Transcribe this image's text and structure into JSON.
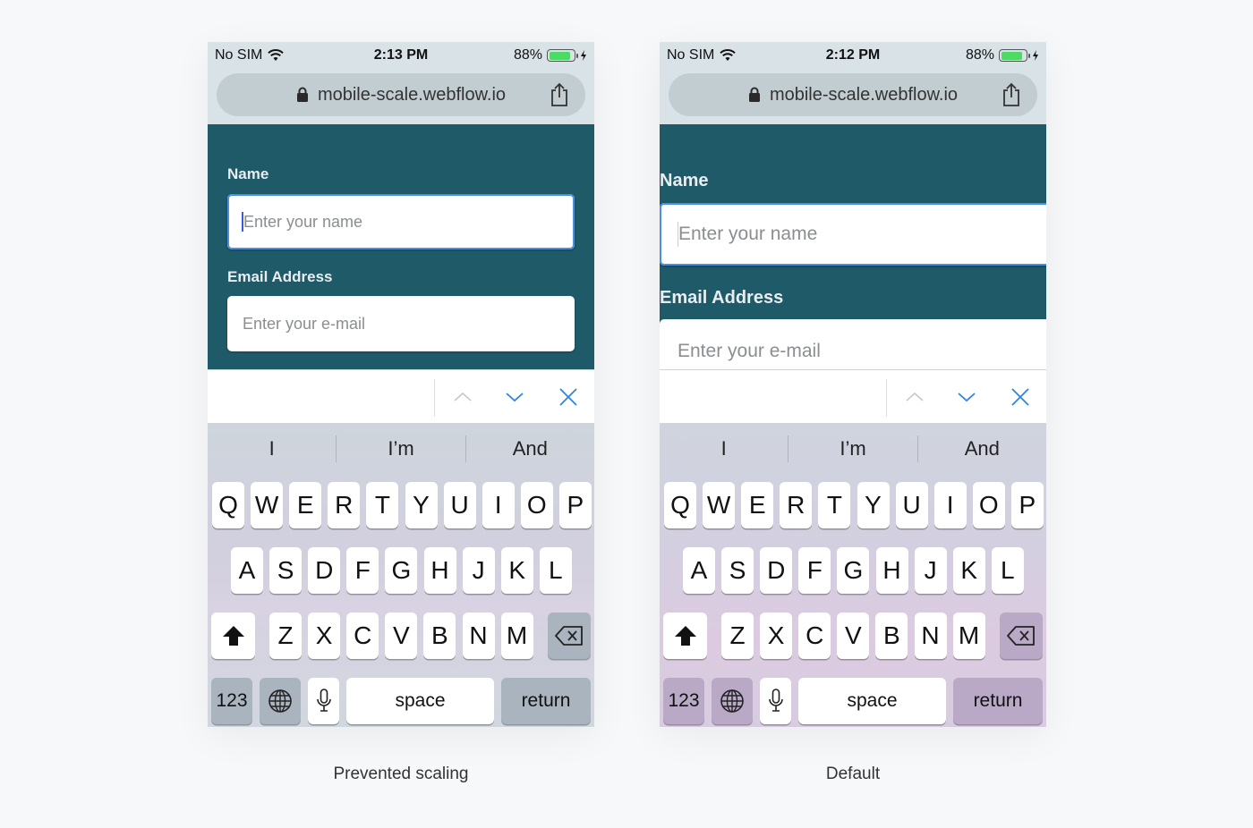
{
  "colors": {
    "page_bg": "#1f5a68",
    "chrome_bg": "#d9e2e6",
    "accent_blue": "#4a90e2",
    "battery_green": "#4cd964"
  },
  "phones": [
    {
      "id": "left",
      "status": {
        "carrier": "No SIM",
        "time": "2:13 PM",
        "battery": "88%",
        "battery_level": 0.88
      },
      "url": "mobile-scale.webflow.io",
      "form": {
        "name_label": "Name",
        "name_placeholder": "Enter your name",
        "email_label": "Email Address",
        "email_placeholder": "Enter your e-mail"
      },
      "caption": "Prevented scaling"
    },
    {
      "id": "right",
      "status": {
        "carrier": "No SIM",
        "time": "2:12 PM",
        "battery": "88%",
        "battery_level": 0.88
      },
      "url": "mobile-scale.webflow.io",
      "form": {
        "name_label": "Name",
        "name_placeholder": "Enter your name",
        "email_label": "Email Address",
        "email_placeholder": "Enter your e-mail"
      },
      "caption": "Default"
    }
  ],
  "keyboard": {
    "suggestions": [
      "I",
      "I’m",
      "And"
    ],
    "row1": [
      "Q",
      "W",
      "E",
      "R",
      "T",
      "Y",
      "U",
      "I",
      "O",
      "P"
    ],
    "row2": [
      "A",
      "S",
      "D",
      "F",
      "G",
      "H",
      "J",
      "K",
      "L"
    ],
    "row3": [
      "Z",
      "X",
      "C",
      "V",
      "B",
      "N",
      "M"
    ],
    "numbers_label": "123",
    "space_label": "space",
    "return_label": "return"
  },
  "icons": {
    "wifi": "wifi-icon",
    "lock": "lock-icon",
    "share": "share-icon",
    "prev": "chevron-up-icon",
    "next": "chevron-down-icon",
    "done": "close-icon",
    "shift": "shift-icon",
    "delete": "backspace-icon",
    "globe": "globe-icon",
    "mic": "microphone-icon"
  }
}
